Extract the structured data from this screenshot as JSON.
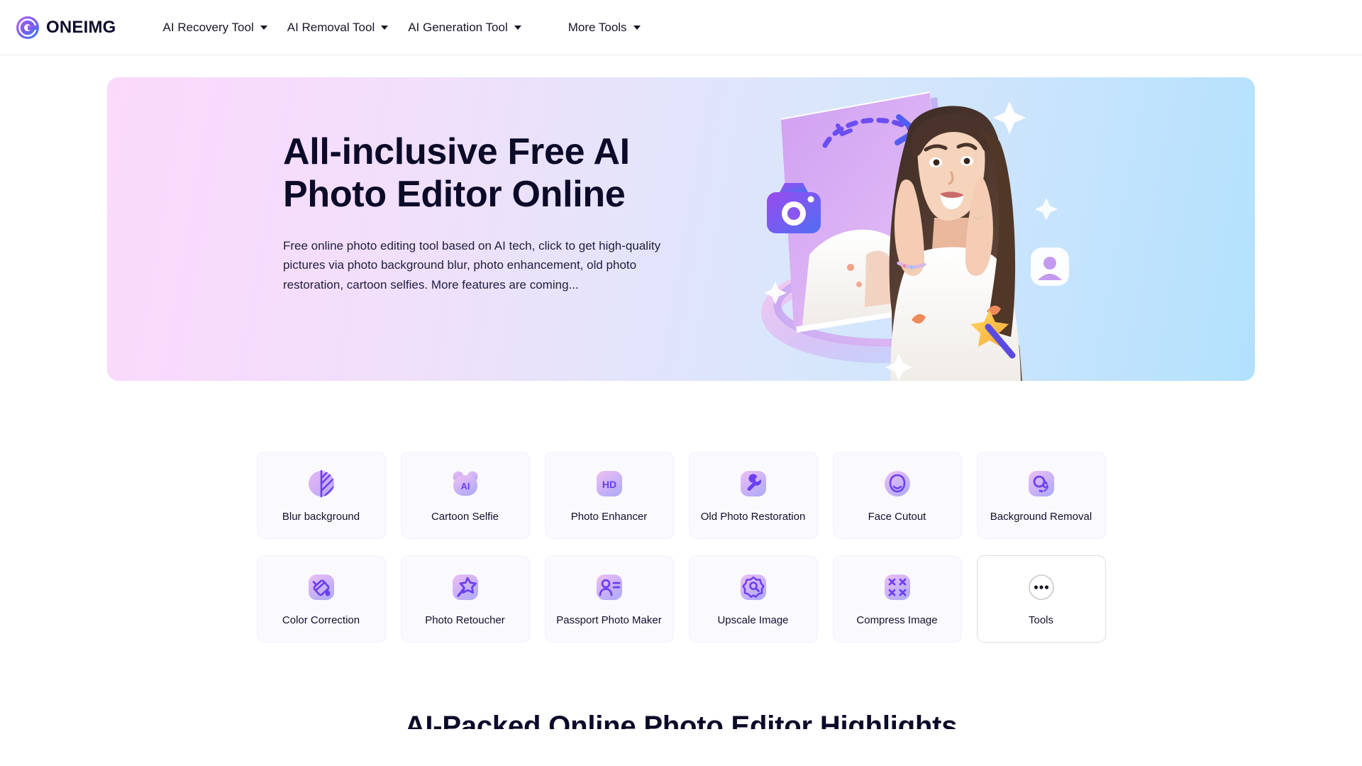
{
  "header": {
    "brand": {
      "name": "ONEIMG",
      "icon": "oneimg-logo-icon"
    },
    "nav": [
      {
        "label": "AI Recovery Tool",
        "caret": "chevron-down-icon"
      },
      {
        "label": "AI Removal Tool",
        "caret": "chevron-down-icon"
      },
      {
        "label": "AI Generation Tool",
        "caret": "chevron-down-icon"
      },
      {
        "label": "More Tools",
        "caret": "chevron-down-icon"
      }
    ]
  },
  "hero": {
    "title_line1": "All-inclusive Free AI",
    "title_line2": "Photo Editor Online",
    "subtitle": "Free online photo editing tool based on AI tech, click to get high-quality pictures via photo background blur, photo enhancement, old photo restoration, cartoon selfies. More features are coming...",
    "gradient_from": "#fbd9fb",
    "gradient_to": "#b2e1fd",
    "illustration": "woman-photo-frame-illustration"
  },
  "tools": [
    {
      "label": "Blur background",
      "icon": "blur-background-icon"
    },
    {
      "label": "Cartoon Selfie",
      "icon": "cartoon-selfie-ai-bear-icon"
    },
    {
      "label": "Photo Enhancer",
      "icon": "hd-badge-icon"
    },
    {
      "label": "Old Photo Restoration",
      "icon": "wrench-icon"
    },
    {
      "label": "Face Cutout",
      "icon": "face-outline-icon"
    },
    {
      "label": "Background Removal",
      "icon": "background-removal-icon"
    },
    {
      "label": "Color Correction",
      "icon": "paint-bucket-icon"
    },
    {
      "label": "Photo Retoucher",
      "icon": "magic-wand-star-icon"
    },
    {
      "label": "Passport Photo Maker",
      "icon": "person-id-icon"
    },
    {
      "label": "Upscale Image",
      "icon": "upscale-badge-icon"
    },
    {
      "label": "Compress Image",
      "icon": "compress-arrows-icon"
    },
    {
      "label": "Tools",
      "icon": "more-dots-circle-icon"
    }
  ],
  "teaser": {
    "heading": "AI-Packed Online Photo Editor Highlights"
  },
  "colors": {
    "accent_purple": "#6b3ff0",
    "icon_tile_from": "#efc5f5",
    "icon_tile_to": "#b9b0f7",
    "text_dark": "#0b0a29",
    "card_bg": "#faf9fe"
  }
}
